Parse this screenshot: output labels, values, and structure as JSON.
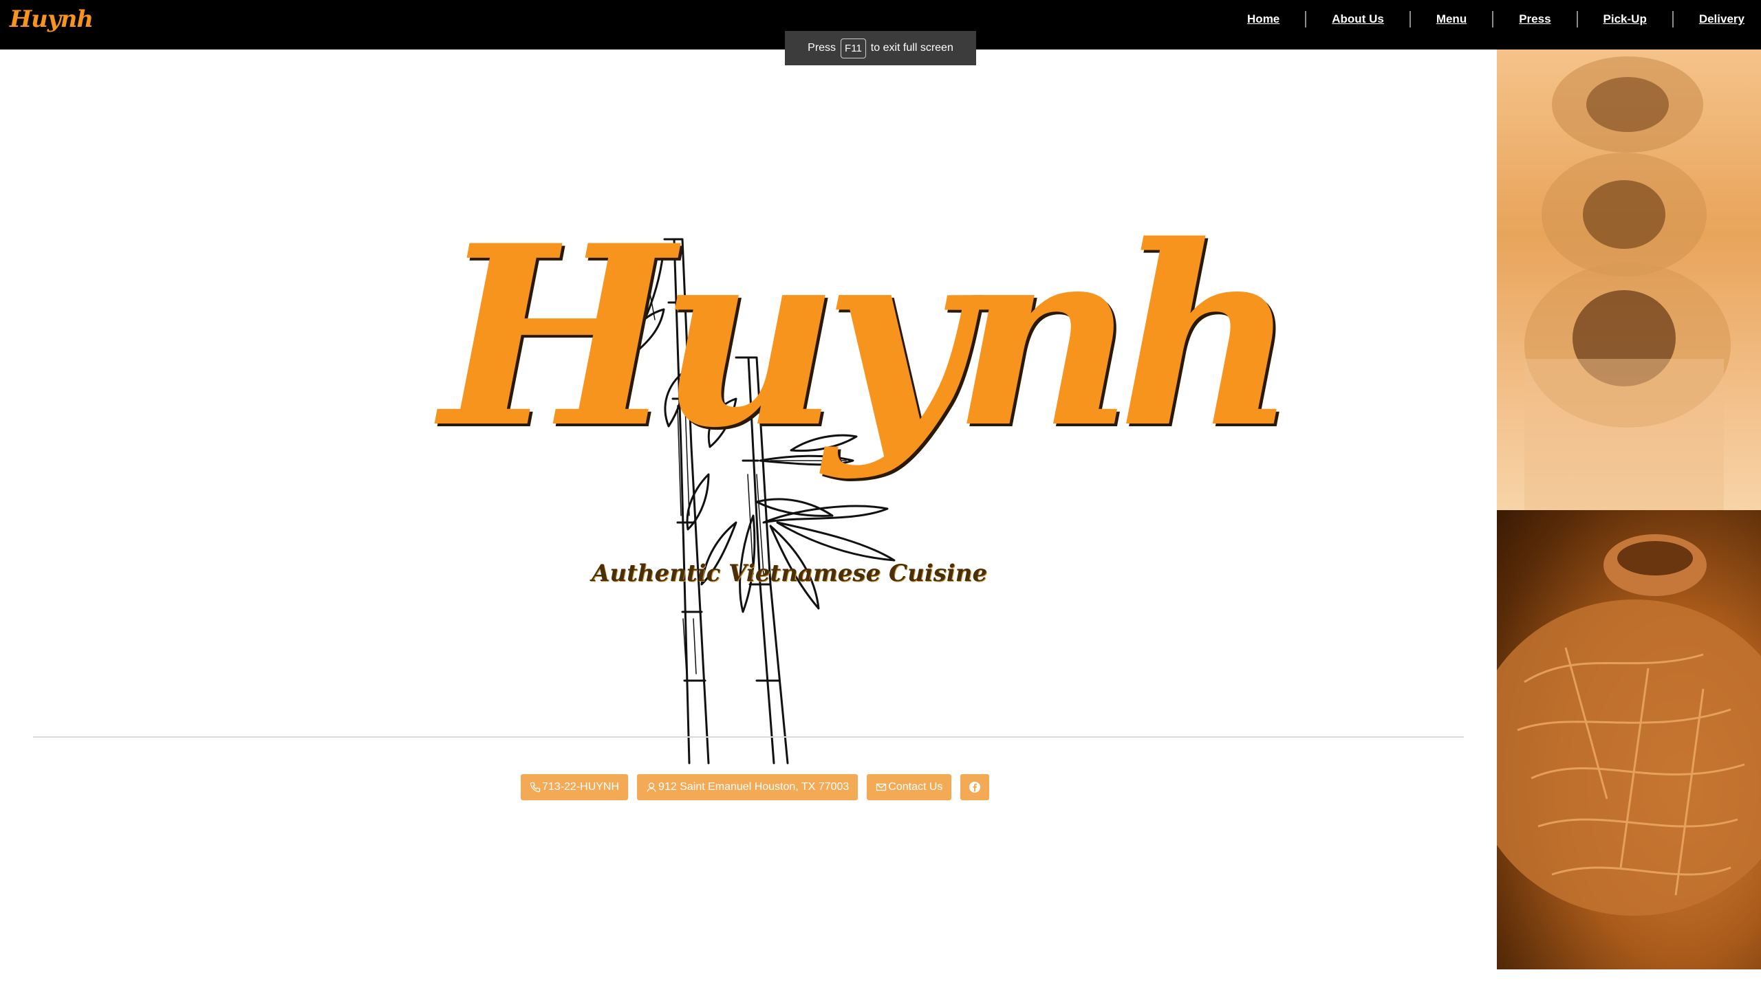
{
  "brand": {
    "logo_text": "Huynh",
    "accent_color": "#f7941d"
  },
  "nav": {
    "items": [
      {
        "label": "Home"
      },
      {
        "label": "About Us"
      },
      {
        "label": "Menu"
      },
      {
        "label": "Press"
      },
      {
        "label": "Pick-Up"
      },
      {
        "label": "Delivery"
      }
    ]
  },
  "fullscreen_notice": {
    "prefix": "Press",
    "key": "F11",
    "suffix": "to exit full screen"
  },
  "hero": {
    "title": "Huynh",
    "tagline": "Authentic Vietnamese Cuisine"
  },
  "contact": {
    "phone_label": "713-22-HUYNH",
    "phone_icon": "phone-icon",
    "address_label": "912 Saint Emanuel Houston, TX 77003",
    "address_icon": "map-pin-icon",
    "contact_label": "Contact Us",
    "contact_icon": "envelope-icon",
    "social_icon": "facebook-icon",
    "button_color": "#f4aa55"
  },
  "side_images": {
    "top": "spring-rolls-photo",
    "bottom": "noodle-dish-photo"
  }
}
